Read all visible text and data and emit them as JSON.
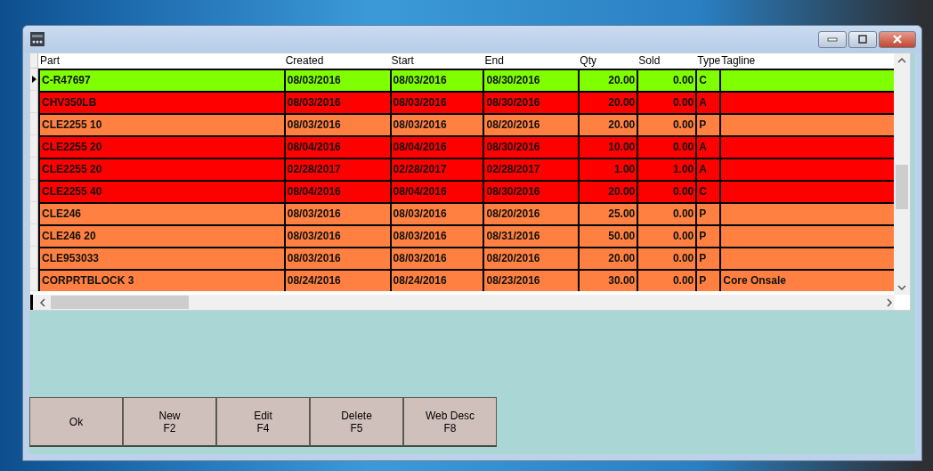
{
  "grid": {
    "columns": [
      {
        "label": "Part",
        "kind": "text"
      },
      {
        "label": "Created",
        "kind": "text"
      },
      {
        "label": "Start",
        "kind": "text"
      },
      {
        "label": "End",
        "kind": "text"
      },
      {
        "label": "Qty",
        "kind": "number"
      },
      {
        "label": "Sold",
        "kind": "number"
      },
      {
        "label": "Type",
        "kind": "text"
      },
      {
        "label": "Tagline",
        "kind": "text"
      }
    ],
    "rows": [
      {
        "selected": true,
        "color": "#80ff00",
        "cells": [
          "C-R47697",
          "08/03/2016",
          "08/03/2016",
          "08/30/2016",
          "20.00",
          "0.00",
          "C",
          ""
        ]
      },
      {
        "selected": false,
        "color": "#ff0000",
        "cells": [
          "CHV350LB",
          "08/03/2016",
          "08/03/2016",
          "08/30/2016",
          "20.00",
          "0.00",
          "A",
          ""
        ]
      },
      {
        "selected": false,
        "color": "#ff8040",
        "cells": [
          "CLE2255 10",
          "08/03/2016",
          "08/03/2016",
          "08/20/2016",
          "20.00",
          "0.00",
          "P",
          ""
        ]
      },
      {
        "selected": false,
        "color": "#ff0000",
        "cells": [
          "CLE2255 20",
          "08/04/2016",
          "08/04/2016",
          "08/30/2016",
          "10.00",
          "0.00",
          "A",
          ""
        ]
      },
      {
        "selected": false,
        "color": "#ff0000",
        "cells": [
          "CLE2255 20",
          "02/28/2017",
          "02/28/2017",
          "02/28/2017",
          "1.00",
          "1.00",
          "A",
          ""
        ]
      },
      {
        "selected": false,
        "color": "#ff0000",
        "cells": [
          "CLE2255 40",
          "08/04/2016",
          "08/04/2016",
          "08/30/2016",
          "20.00",
          "0.00",
          "C",
          ""
        ]
      },
      {
        "selected": false,
        "color": "#ff8040",
        "cells": [
          "CLE246",
          "08/03/2016",
          "08/03/2016",
          "08/20/2016",
          "25.00",
          "0.00",
          "P",
          ""
        ]
      },
      {
        "selected": false,
        "color": "#ff8040",
        "cells": [
          "CLE246 20",
          "08/03/2016",
          "08/03/2016",
          "08/31/2016",
          "50.00",
          "0.00",
          "P",
          ""
        ]
      },
      {
        "selected": false,
        "color": "#ff8040",
        "cells": [
          "CLE953033",
          "08/03/2016",
          "08/03/2016",
          "08/20/2016",
          "20.00",
          "0.00",
          "P",
          ""
        ]
      },
      {
        "selected": false,
        "color": "#ff8040",
        "cells": [
          "CORPRTBLOCK 3",
          "08/24/2016",
          "08/24/2016",
          "08/23/2016",
          "30.00",
          "0.00",
          "P",
          "Core Onsale"
        ]
      }
    ]
  },
  "buttons": [
    {
      "label": "Ok"
    },
    {
      "label": "New",
      "key": "F2"
    },
    {
      "label": "Edit",
      "key": "F4"
    },
    {
      "label": "Delete",
      "key": "F5"
    },
    {
      "label": "Web Desc",
      "key": "F8"
    }
  ]
}
